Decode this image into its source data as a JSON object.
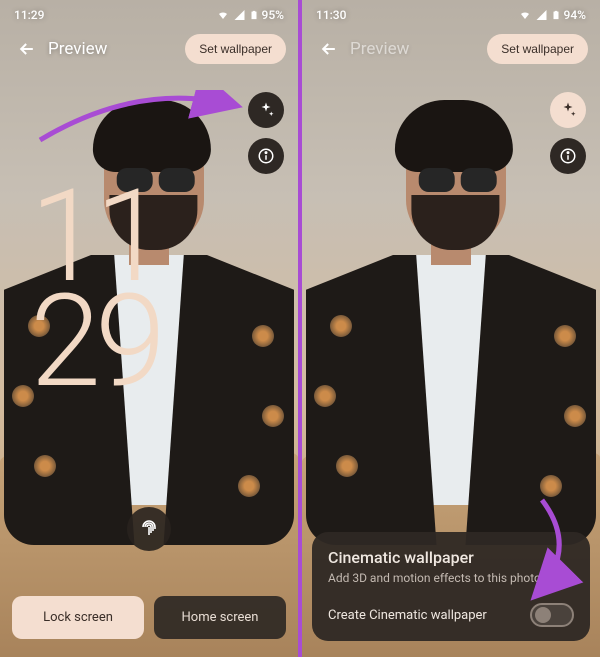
{
  "left": {
    "status": {
      "time": "11:29",
      "battery": "95%"
    },
    "header": {
      "title": "Preview",
      "set_btn": "Set wallpaper"
    },
    "fabs": {
      "sparkle": "sparkle-icon",
      "info": "info-icon"
    },
    "clock": {
      "hour": "11",
      "minute": "29"
    },
    "tabs": {
      "lock": "Lock screen",
      "home": "Home screen"
    }
  },
  "right": {
    "status": {
      "time": "11:30",
      "battery": "94%"
    },
    "header": {
      "title": "Preview",
      "set_btn": "Set wallpaper"
    },
    "fabs": {
      "sparkle": "sparkle-icon",
      "info": "info-icon"
    },
    "panel": {
      "title": "Cinematic wallpaper",
      "subtitle": "Add 3D and motion effects to this photo",
      "toggle_label": "Create Cinematic wallpaper",
      "toggle_on": false
    }
  },
  "colors": {
    "accent_arrow": "#a84cd4"
  }
}
